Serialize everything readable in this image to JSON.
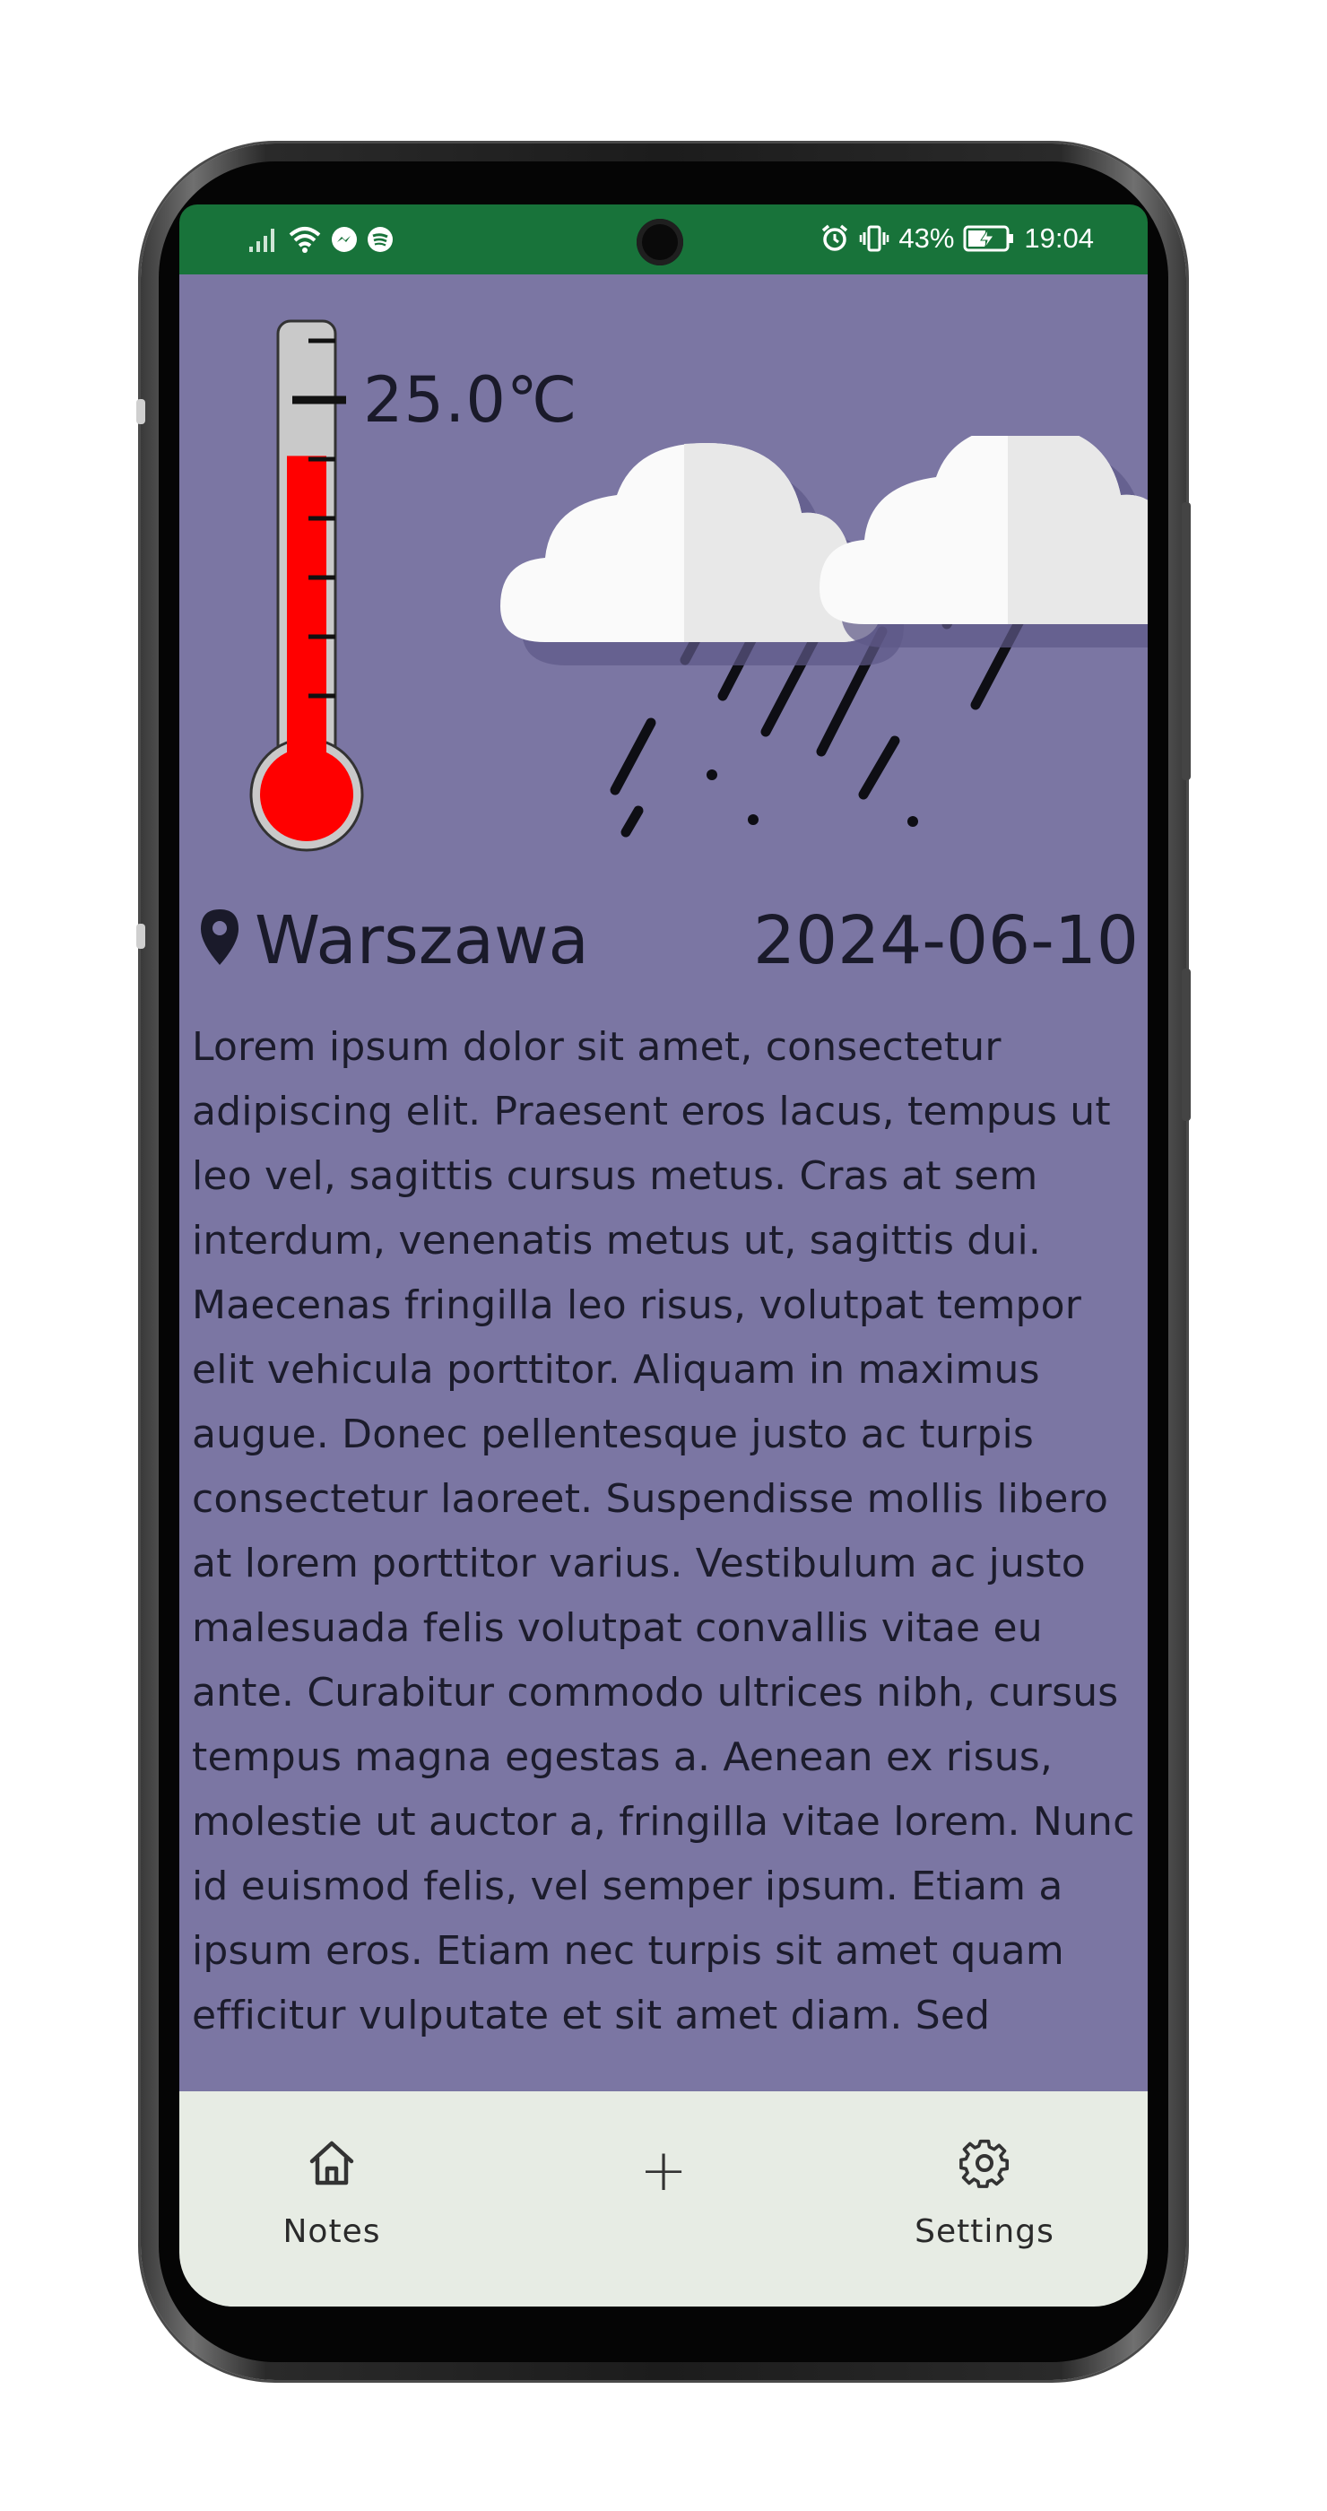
{
  "status_bar": {
    "battery_percent": "43%",
    "time": "19:04",
    "icons": [
      "signal-icon",
      "wifi-icon",
      "messenger-icon",
      "spotify-icon",
      "alarm-icon",
      "vibrate-icon",
      "battery-charging-icon"
    ]
  },
  "weather": {
    "temperature": "25.0℃",
    "thermometer_level": 0.72,
    "condition_icon": "rain-cloud-icon"
  },
  "location": {
    "city": "Warszawa",
    "date": "2024-06-10"
  },
  "note": {
    "text": "Lorem ipsum dolor sit amet, consectetur adipiscing elit. Praesent eros lacus, tempus ut leo vel, sagittis cursus metus. Cras at sem interdum, venenatis metus ut, sagittis dui. Maecenas fringilla leo risus, volutpat tempor elit vehicula porttitor. Aliquam in maximus augue. Donec pellentesque justo ac turpis consectetur laoreet. Suspendisse mollis libero at lorem porttitor varius. Vestibulum ac justo malesuada felis volutpat convallis vitae eu ante. Curabitur commodo ultrices nibh, cursus tempus magna egestas a. Aenean ex risus, molestie ut auctor a, fringilla vitae lorem. Nunc id euismod felis, vel semper ipsum. Etiam a ipsum eros. Etiam nec turpis sit amet quam efficitur vulputate et sit amet diam. Sed"
  },
  "bottom_nav": {
    "notes_label": "Notes",
    "add_label": "+",
    "settings_label": "Settings"
  },
  "colors": {
    "status_bar": "#18733a",
    "content_background": "#7b76a3",
    "nav_background": "#e7ece4",
    "mercury": "#ff0000"
  }
}
